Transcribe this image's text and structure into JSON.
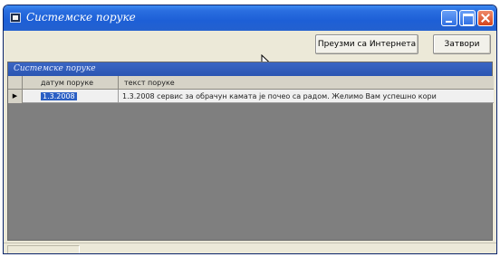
{
  "window": {
    "title": "Системске поруке"
  },
  "toolbar": {
    "download_label": "Преузми са Интернета",
    "close_label": "Затвори"
  },
  "grid": {
    "caption": "Системске поруке",
    "columns": [
      "датум поруке",
      "текст поруке"
    ],
    "rows": [
      {
        "indicator": "▶",
        "date": "1.3.2008",
        "text": "1.3.2008 сервис за обрачун камата је почео са радом. Желимо Вам успешно кори"
      }
    ]
  },
  "colors": {
    "titlebar": "#2461cf",
    "grid_background": "#7f7f7f",
    "selection": "#2b5fc4"
  }
}
